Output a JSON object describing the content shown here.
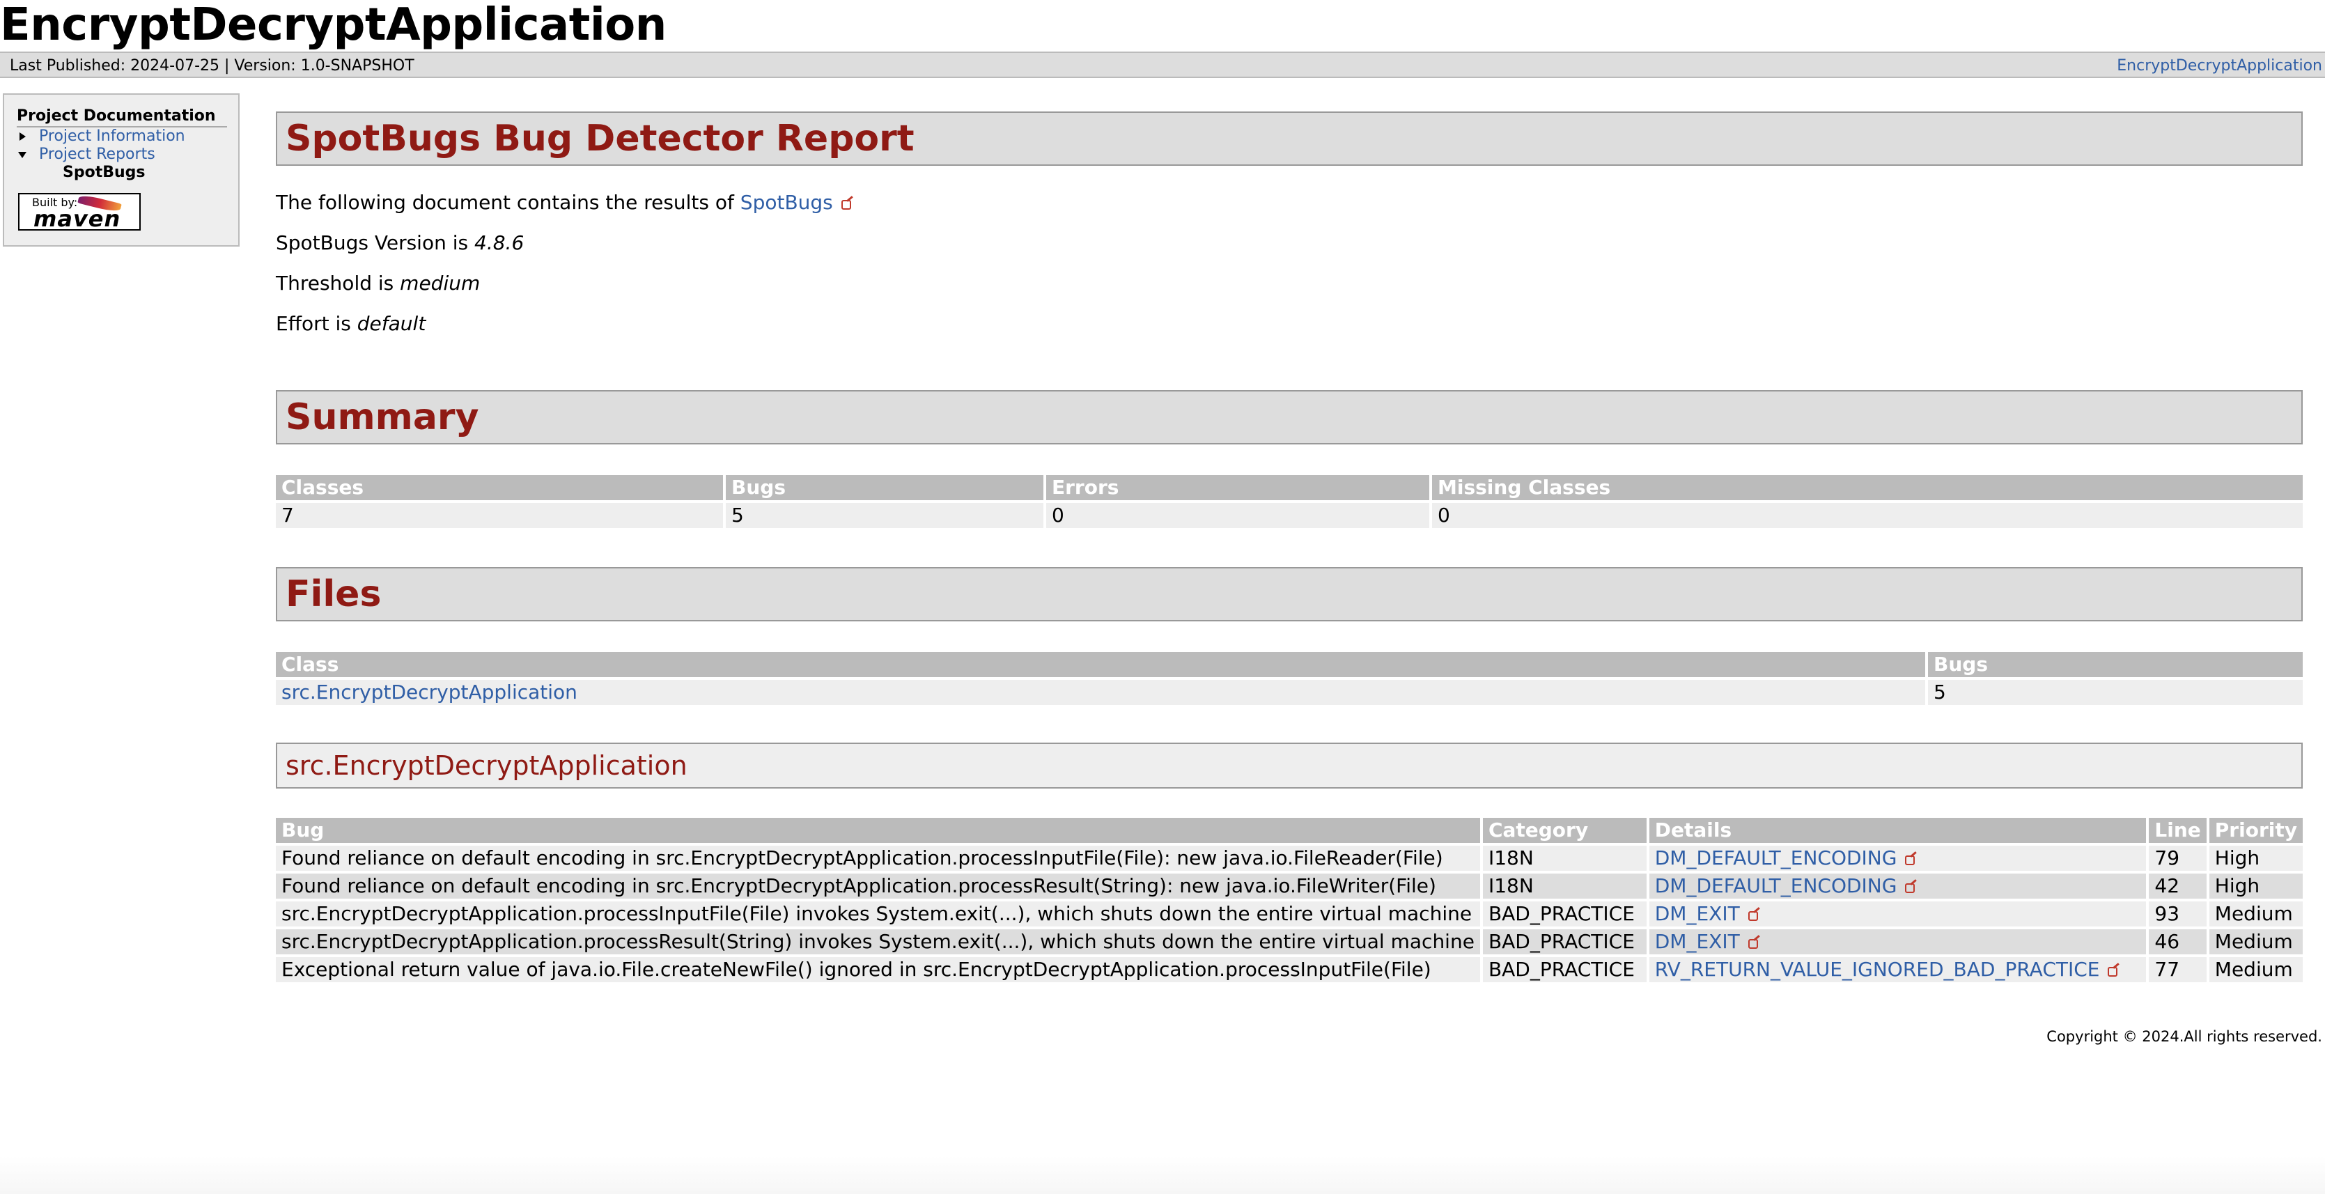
{
  "banner": {
    "title": "EncryptDecryptApplication"
  },
  "breadcrumbs": {
    "text": "Last Published: 2024-07-25  | Version: 1.0-SNAPSHOT",
    "right_link": "EncryptDecryptApplication"
  },
  "sidebar": {
    "heading": "Project Documentation",
    "items": [
      {
        "label": "Project Information",
        "icon": "triangle-right"
      },
      {
        "label": "Project Reports",
        "icon": "triangle-down"
      }
    ],
    "sub_item": "SpotBugs",
    "logo": {
      "built_by": "Built by:",
      "brand": "maven"
    }
  },
  "report": {
    "title": "SpotBugs Bug Detector Report",
    "intro_prefix": "The following document contains the results of ",
    "intro_link": "SpotBugs",
    "version_prefix": "SpotBugs Version is ",
    "version": "4.8.6",
    "threshold_prefix": "Threshold is ",
    "threshold": "medium",
    "effort_prefix": "Effort is ",
    "effort": "default"
  },
  "summary": {
    "title": "Summary",
    "headers": [
      "Classes",
      "Bugs",
      "Errors",
      "Missing Classes"
    ],
    "row": [
      "7",
      "5",
      "0",
      "0"
    ]
  },
  "files": {
    "title": "Files",
    "headers": [
      "Class",
      "Bugs"
    ],
    "row": {
      "class": "src.EncryptDecryptApplication",
      "bugs": "5"
    }
  },
  "class_section": {
    "title": "src.EncryptDecryptApplication",
    "headers": [
      "Bug",
      "Category",
      "Details",
      "Line",
      "Priority"
    ],
    "rows": [
      {
        "bug": "Found reliance on default encoding in src.EncryptDecryptApplication.processInputFile(File): new java.io.FileReader(File)",
        "category": "I18N",
        "details": "DM_DEFAULT_ENCODING",
        "line": "79",
        "priority": "High"
      },
      {
        "bug": "Found reliance on default encoding in src.EncryptDecryptApplication.processResult(String): new java.io.FileWriter(File)",
        "category": "I18N",
        "details": "DM_DEFAULT_ENCODING",
        "line": "42",
        "priority": "High"
      },
      {
        "bug": "src.EncryptDecryptApplication.processInputFile(File) invokes System.exit(...), which shuts down the entire virtual machine",
        "category": "BAD_PRACTICE",
        "details": "DM_EXIT",
        "line": "93",
        "priority": "Medium"
      },
      {
        "bug": "src.EncryptDecryptApplication.processResult(String) invokes System.exit(...), which shuts down the entire virtual machine",
        "category": "BAD_PRACTICE",
        "details": "DM_EXIT",
        "line": "46",
        "priority": "Medium"
      },
      {
        "bug": "Exceptional return value of java.io.File.createNewFile() ignored in src.EncryptDecryptApplication.processInputFile(File)",
        "category": "BAD_PRACTICE",
        "details": "RV_RETURN_VALUE_IGNORED_BAD_PRACTICE",
        "line": "77",
        "priority": "Medium"
      }
    ]
  },
  "footer": {
    "copyright": "Copyright © 2024.All rights reserved."
  }
}
